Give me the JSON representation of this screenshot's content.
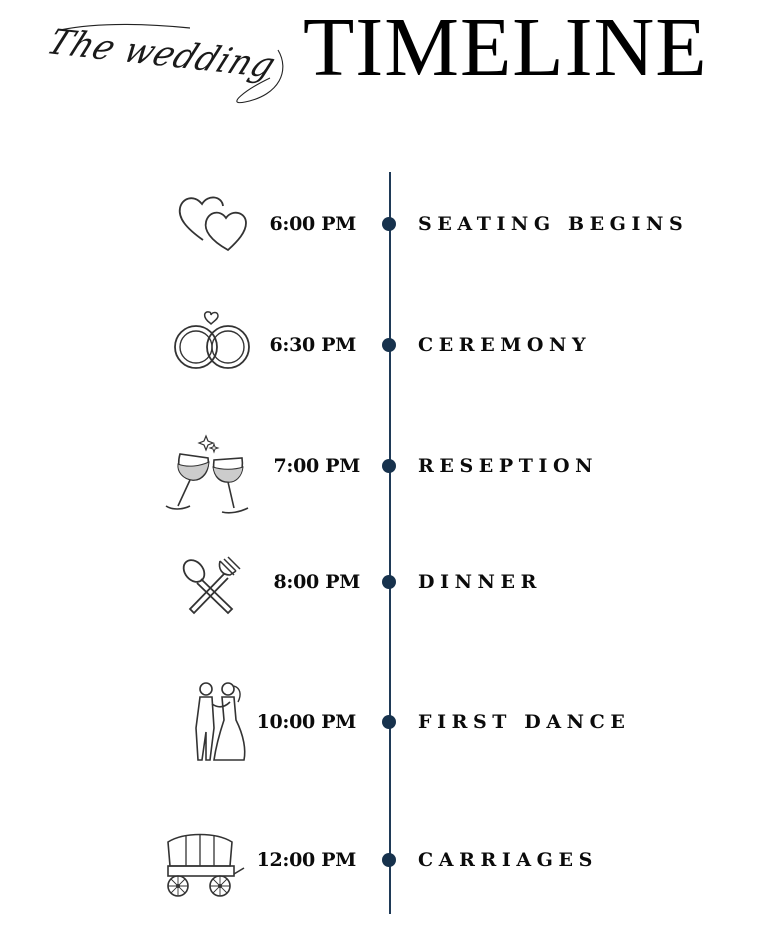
{
  "header": {
    "script_text": "The wedding",
    "title": "TIMELINE"
  },
  "colors": {
    "line": "#1f3a57",
    "dot": "#17324d",
    "text": "#0b0b0b"
  },
  "events": [
    {
      "time": "6:00 PM",
      "label": "SEATING BEGINS",
      "icon": "hearts-icon"
    },
    {
      "time": "6:30 PM",
      "label": "CEREMONY",
      "icon": "rings-icon"
    },
    {
      "time": "7:00 PM",
      "label": "RESEPTION",
      "icon": "wine-glasses-icon"
    },
    {
      "time": "8:00 PM",
      "label": "DINNER",
      "icon": "fork-spoon-icon"
    },
    {
      "time": "10:00 PM",
      "label": "FIRST DANCE",
      "icon": "couple-dance-icon"
    },
    {
      "time": "12:00 PM",
      "label": "CARRIAGES",
      "icon": "carriage-icon"
    }
  ]
}
